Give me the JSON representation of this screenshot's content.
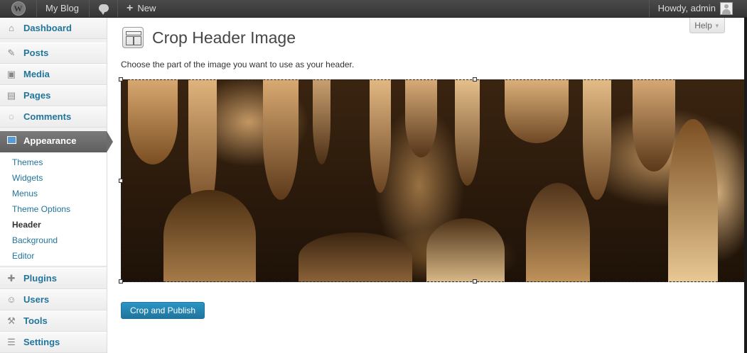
{
  "admin_bar": {
    "site_name": "My Blog",
    "new_label": "New",
    "howdy": "Howdy, admin"
  },
  "sidebar": {
    "items": [
      {
        "label": "Dashboard",
        "icon": "dashboard-icon"
      },
      {
        "label": "Posts",
        "icon": "pin-icon"
      },
      {
        "label": "Media",
        "icon": "media-icon"
      },
      {
        "label": "Pages",
        "icon": "pages-icon"
      },
      {
        "label": "Comments",
        "icon": "comments-icon"
      },
      {
        "label": "Appearance",
        "icon": "appearance-icon"
      },
      {
        "label": "Plugins",
        "icon": "plugins-icon"
      },
      {
        "label": "Users",
        "icon": "users-icon"
      },
      {
        "label": "Tools",
        "icon": "tools-icon"
      },
      {
        "label": "Settings",
        "icon": "settings-icon"
      }
    ],
    "appearance_submenu": [
      {
        "label": "Themes"
      },
      {
        "label": "Widgets"
      },
      {
        "label": "Menus"
      },
      {
        "label": "Theme Options"
      },
      {
        "label": "Header",
        "current": true
      },
      {
        "label": "Background"
      },
      {
        "label": "Editor"
      }
    ]
  },
  "help_tab": {
    "label": "Help"
  },
  "page": {
    "title": "Crop Header Image",
    "instructions": "Choose the part of the image you want to use as your header.",
    "crop_button": "Crop and Publish"
  },
  "colors": {
    "link": "#21759b",
    "admin_bar": "#464646",
    "primary_button": "#21759b",
    "active_menu": "#6d6d6d"
  }
}
